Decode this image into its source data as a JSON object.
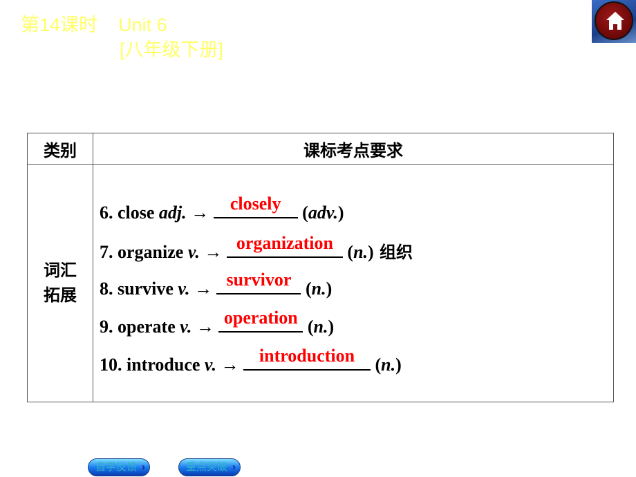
{
  "header": {
    "lesson": "第14课时",
    "unit": "Unit 6",
    "grade": "[八年级下册]"
  },
  "home_button": {
    "icon": "home-icon"
  },
  "table": {
    "headers": [
      "类别",
      "课标考点要求"
    ],
    "category": "词汇\n拓展",
    "category_line1": "词汇",
    "category_line2": "拓展",
    "items": [
      {
        "prefix": "6. close ",
        "pos": "adj.",
        "arrow": " → ",
        "answer": "closely",
        "suffix_open": " (",
        "suffix_pos": "adv.",
        "suffix_close": ")",
        "extra": ""
      },
      {
        "prefix": "7. organize ",
        "pos": "v.",
        "arrow": " → ",
        "answer": "organization",
        "suffix_open": " (",
        "suffix_pos": "n.",
        "suffix_close": ")",
        "extra": " 组织"
      },
      {
        "prefix": "8. survive ",
        "pos": "v.",
        "arrow": " → ",
        "answer": "survivor",
        "suffix_open": " (",
        "suffix_pos": "n.",
        "suffix_close": ")",
        "extra": ""
      },
      {
        "prefix": "9. operate ",
        "pos": "v.",
        "arrow": " → ",
        "answer": "operation",
        "suffix_open": " (",
        "suffix_pos": "n.",
        "suffix_close": ")",
        "extra": ""
      },
      {
        "prefix": "10. introduce ",
        "pos": "v.",
        "arrow": " → ",
        "answer": "introduction",
        "suffix_open": " (",
        "suffix_pos": "n.",
        "suffix_close": ")",
        "extra": ""
      }
    ]
  },
  "nav": {
    "self_check": "自学反馈",
    "key_points": "重点突破",
    "arrow": "›"
  },
  "colors": {
    "title": "#ffff66",
    "answer": "#ff0000"
  }
}
